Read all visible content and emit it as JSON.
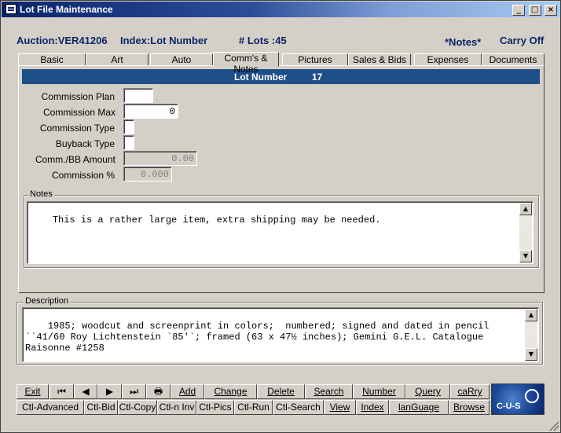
{
  "window": {
    "title": "Lot File Maintenance",
    "controls": [
      "_",
      "□",
      "×"
    ]
  },
  "header": {
    "auction": "Auction:VER41206",
    "index": "Index:Lot Number",
    "lots": "# Lots :45",
    "notes_flag": "*Notes*",
    "carry": "Carry Off"
  },
  "tabs": [
    "Basic",
    "Art",
    "Auto",
    "Comm's & Notes",
    "Pictures",
    "Sales & Bids",
    "Expenses",
    "Documents"
  ],
  "active_tab": "Comm's & Notes",
  "lotbar": {
    "label": "Lot Number",
    "value": "17"
  },
  "fields": {
    "commission_plan": {
      "label": "Commission Plan",
      "value": ""
    },
    "commission_max": {
      "label": "Commission Max",
      "value": "0"
    },
    "commission_type": {
      "label": "Commission Type",
      "value": ""
    },
    "buyback_type": {
      "label": "Buyback Type",
      "value": ""
    },
    "comm_bb_amount": {
      "label": "Comm./BB Amount",
      "value": "0.00"
    },
    "commission_pct": {
      "label": "Commission %",
      "value": "0.000"
    }
  },
  "notes": {
    "label": "Notes",
    "text": "This is a rather large item, extra shipping may be needed."
  },
  "description": {
    "label": "Description",
    "text": "1985; woodcut and screenprint in colors;  numbered; signed and dated in pencil ``41/60 Roy Lichtenstein `85'`; framed (63 x 47½ inches); Gemini G.E.L. Catalogue Raisonne #1258"
  },
  "buttons_row1": [
    "Exit",
    "⏮",
    "◀",
    "▶",
    "⏭",
    "🖶",
    "Add",
    "Change",
    "Delete",
    "Search",
    "Number",
    "Query",
    "caRry"
  ],
  "buttons_row2": [
    "Ctl-Advanced",
    "Ctl-Bid",
    "Ctl-Copy",
    "Ctl-n Inv",
    "Ctl-Pics",
    "Ctl-Run",
    "Ctl-Search",
    "View",
    "Index",
    "lanGuage",
    "Browse"
  ],
  "logo_text": "C-U-S",
  "colors": {
    "title_start": "#0a246a",
    "lotbar": "#1f4f88",
    "header_text": "#0a246a"
  }
}
